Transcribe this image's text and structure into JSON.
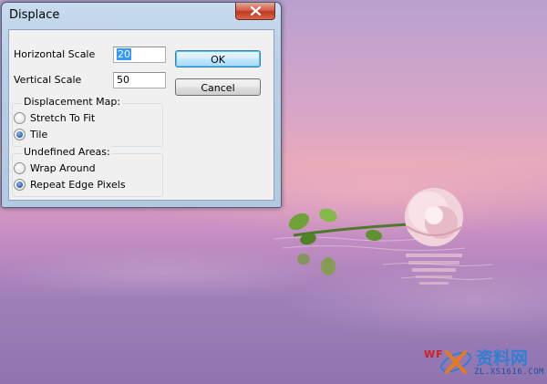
{
  "window": {
    "title": "Displace"
  },
  "fields": {
    "horizontal_scale_label": "Horizontal Scale",
    "horizontal_scale_value": "20",
    "vertical_scale_label": "Vertical Scale",
    "vertical_scale_value": "50"
  },
  "displacement_map": {
    "legend": "Displacement Map:",
    "options": [
      {
        "label": "Stretch To Fit",
        "selected": false
      },
      {
        "label": "Tile",
        "selected": true
      }
    ]
  },
  "undefined_areas": {
    "legend": "Undefined Areas:",
    "options": [
      {
        "label": "Wrap Around",
        "selected": false
      },
      {
        "label": "Repeat Edge Pixels",
        "selected": true
      }
    ]
  },
  "buttons": {
    "ok_label": "OK",
    "cancel_label": "Cancel"
  },
  "watermark": {
    "tag": "WF",
    "title": "资料网",
    "url": "ZL.XS1616.COM"
  },
  "colors": {
    "accent": "#3399ff",
    "close_button": "#c13a22",
    "watermark_blue": "#2f7fd2"
  }
}
